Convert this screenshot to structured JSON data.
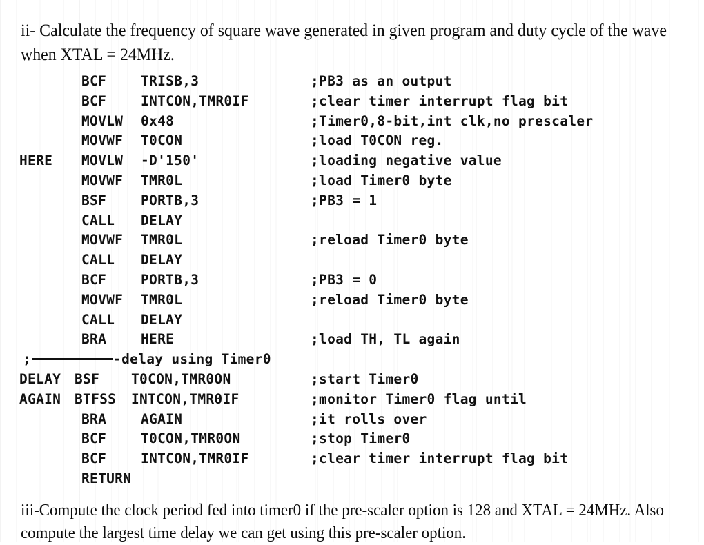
{
  "document": {
    "intro_paragraph": "ii- Calculate the frequency of square wave generated in given program and duty cycle of the wave when XTAL = 24MHz.",
    "closing_paragraph": "iii-Compute the clock period fed into timer0 if the pre-scaler option is 128 and XTAL = 24MHz. Also compute the largest time delay we can get using this pre-scaler option."
  },
  "code_listing": {
    "separator": {
      "semicolon": ";",
      "tail": "-delay using Timer0"
    },
    "lines": [
      {
        "label": "",
        "mnemonic": "BCF",
        "operand": "TRISB,3",
        "comment": ";PB3 as an output"
      },
      {
        "label": "",
        "mnemonic": "BCF",
        "operand": "INTCON,TMR0IF",
        "comment": ";clear timer interrupt flag bit"
      },
      {
        "label": "",
        "mnemonic": "MOVLW",
        "operand": "0x48",
        "comment": ";Timer0,8-bit,int clk,no prescaler"
      },
      {
        "label": "",
        "mnemonic": "MOVWF",
        "operand": "T0CON",
        "comment": ";load T0CON reg."
      },
      {
        "label": "HERE",
        "mnemonic": "MOVLW",
        "operand": "-D'150'",
        "comment": ";loading negative value"
      },
      {
        "label": "",
        "mnemonic": "MOVWF",
        "operand": "TMR0L",
        "comment": ";load Timer0 byte"
      },
      {
        "label": "",
        "mnemonic": "BSF",
        "operand": "PORTB,3",
        "comment": ";PB3 = 1"
      },
      {
        "label": "",
        "mnemonic": "CALL",
        "operand": "DELAY",
        "comment": ""
      },
      {
        "label": "",
        "mnemonic": "MOVWF",
        "operand": "TMR0L",
        "comment": ";reload Timer0 byte"
      },
      {
        "label": "",
        "mnemonic": "CALL",
        "operand": "DELAY",
        "comment": ""
      },
      {
        "label": "",
        "mnemonic": "BCF",
        "operand": "PORTB,3",
        "comment": ";PB3 = 0"
      },
      {
        "label": "",
        "mnemonic": "MOVWF",
        "operand": "TMR0L",
        "comment": ";reload Timer0 byte"
      },
      {
        "label": "",
        "mnemonic": "CALL",
        "operand": "DELAY",
        "comment": ""
      },
      {
        "label": "",
        "mnemonic": "BRA",
        "operand": "HERE",
        "comment": ";load TH, TL again"
      },
      {
        "label": "DELAY",
        "mnemonic": "BSF",
        "operand": "T0CON,TMR0ON",
        "comment": ";start Timer0",
        "tight": true
      },
      {
        "label": "AGAIN",
        "mnemonic": "BTFSS",
        "operand": "INTCON,TMR0IF",
        "comment": ";monitor Timer0 flag until",
        "tight": true
      },
      {
        "label": "",
        "mnemonic": "BRA",
        "operand": "AGAIN",
        "comment": ";it rolls over"
      },
      {
        "label": "",
        "mnemonic": "BCF",
        "operand": "T0CON,TMR0ON",
        "comment": ";stop Timer0"
      },
      {
        "label": "",
        "mnemonic": "BCF",
        "operand": "INTCON,TMR0IF",
        "comment": ";clear timer interrupt flag bit"
      },
      {
        "label": "",
        "mnemonic": "RETURN",
        "operand": "",
        "comment": ""
      }
    ]
  }
}
